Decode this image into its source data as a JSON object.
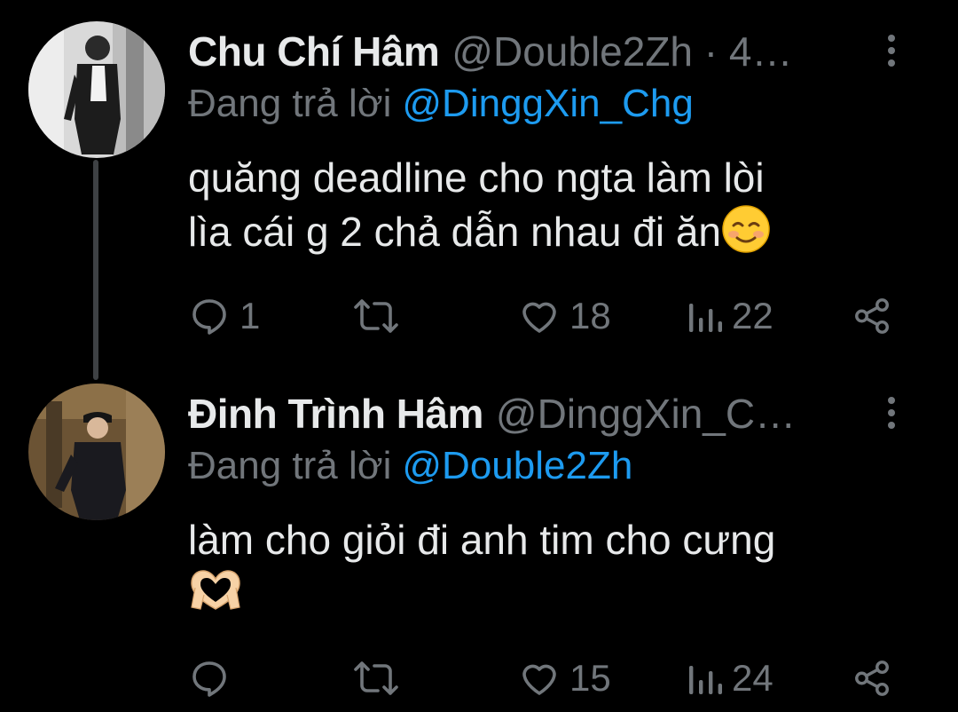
{
  "tweets": [
    {
      "display_name": "Chu Chí Hâm",
      "handle": "@Double2Zh · 4…",
      "replying_prefix": "Đang trả lời",
      "replying_to": "@DinggXin_Chg",
      "text_line1": "quăng deadline cho ngta làm lòi",
      "text_line2": "lìa cái g 2 chả dẫn nhau đi ăn",
      "emoji": "smiling-face-with-blush",
      "stats": {
        "replies": "1",
        "retweets": "",
        "likes": "18",
        "views": "22"
      }
    },
    {
      "display_name": "Đinh Trình Hâm",
      "handle": "@DinggXin_C…",
      "replying_prefix": "Đang trả lời",
      "replying_to": "@Double2Zh",
      "text_line1": "làm cho giỏi đi anh tim cho cưng",
      "emoji": "heart-hands",
      "stats": {
        "replies": "",
        "retweets": "",
        "likes": "15",
        "views": "24"
      }
    }
  ],
  "icons": [
    "reply-icon",
    "retweet-icon",
    "like-icon",
    "views-icon",
    "share-icon",
    "more-icon"
  ],
  "colors": {
    "background": "#000000",
    "text": "#E7E9EA",
    "muted": "#71767B",
    "link": "#1D9BF0"
  }
}
